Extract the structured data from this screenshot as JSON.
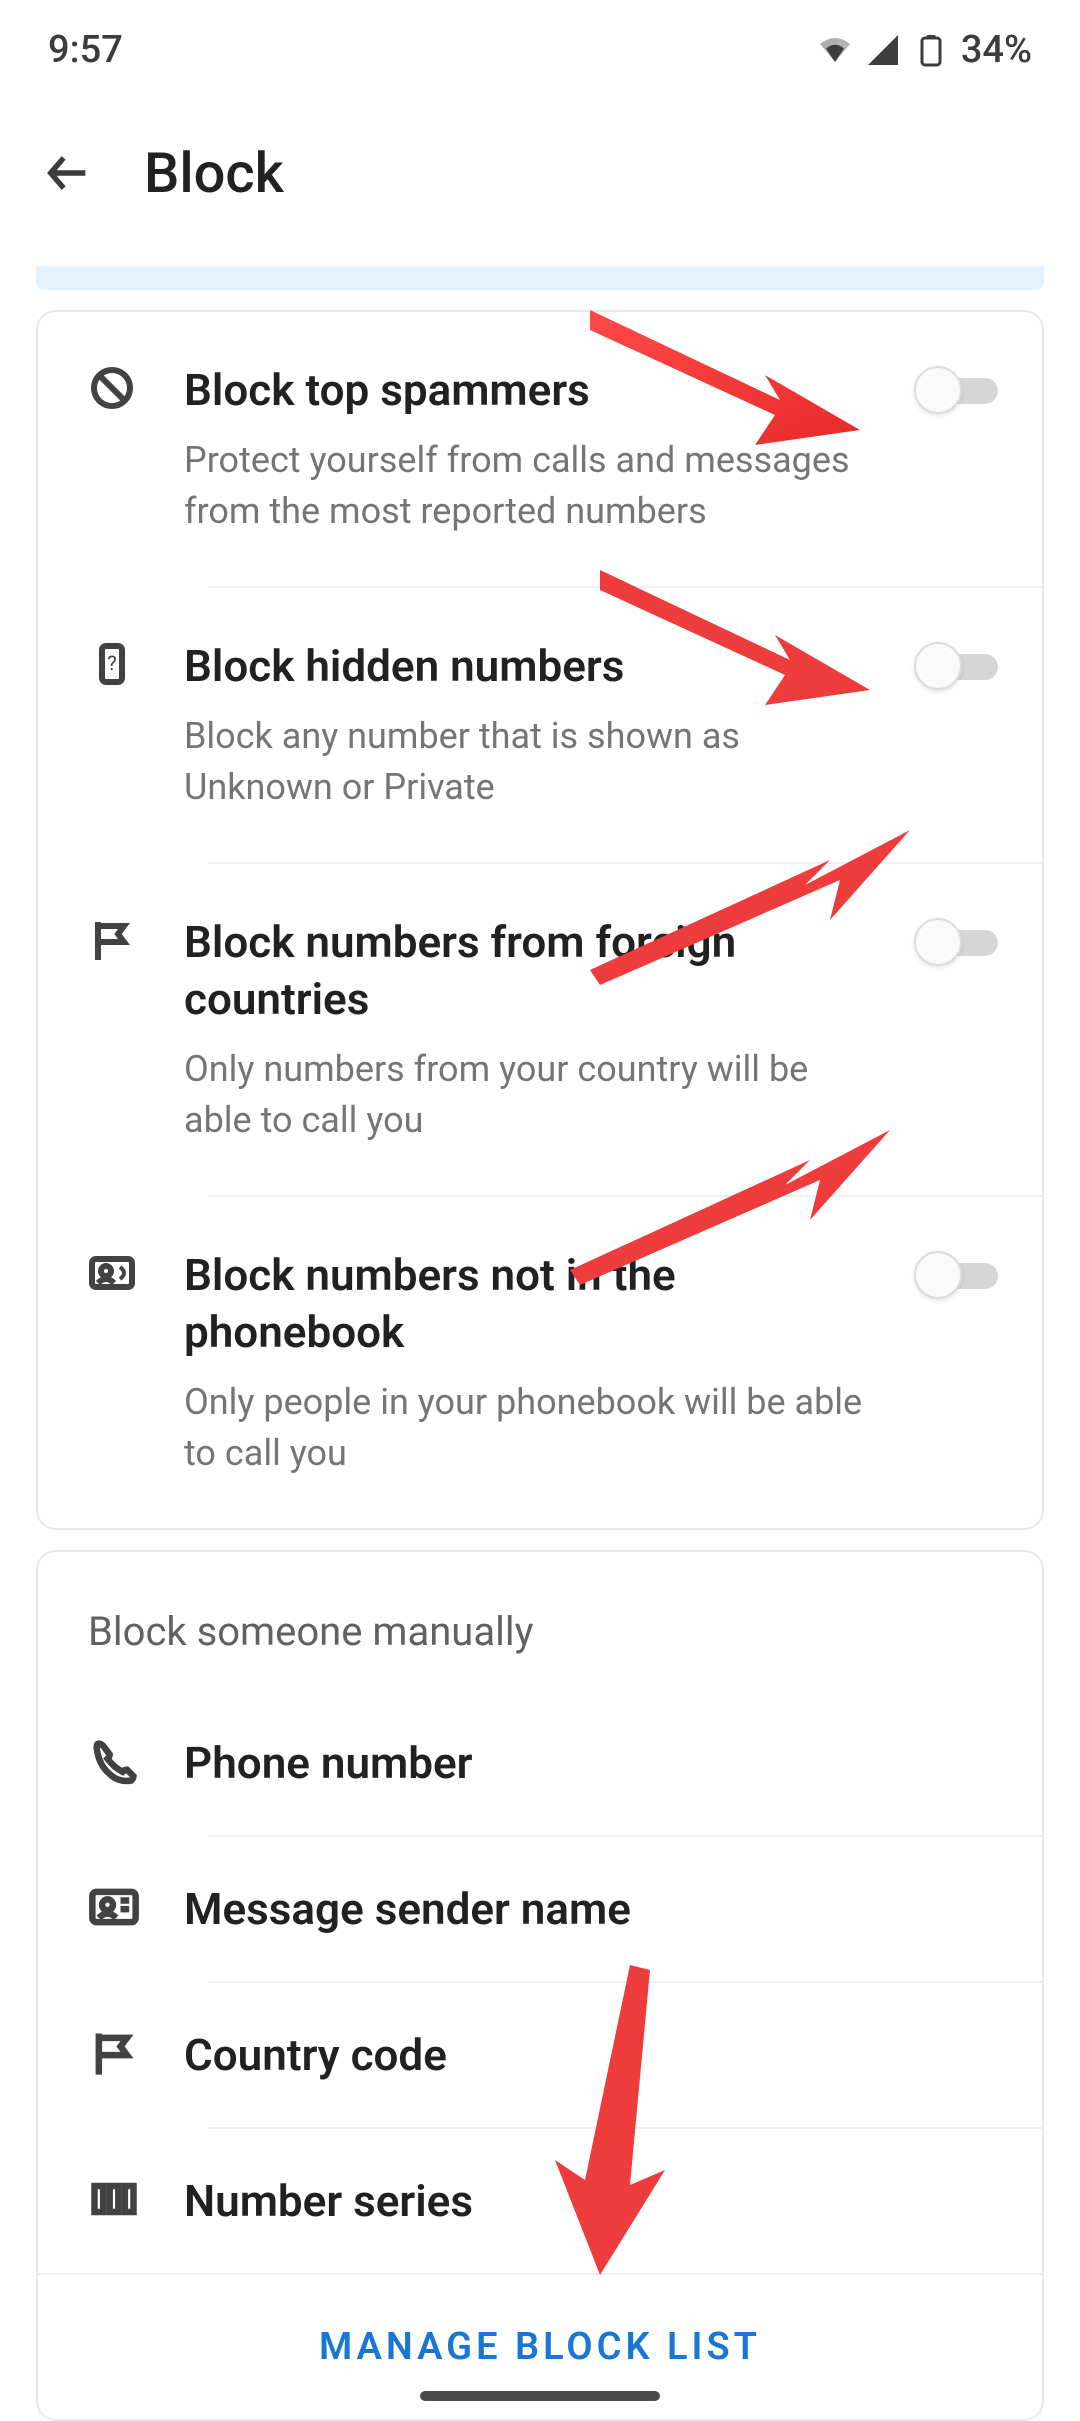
{
  "status": {
    "time": "9:57",
    "battery": "34%"
  },
  "header": {
    "title": "Block"
  },
  "settings_card": {
    "items": [
      {
        "title": "Block top spammers",
        "description": "Protect yourself from calls and messages from the most reported numbers",
        "toggled": false
      },
      {
        "title": "Block hidden numbers",
        "description": "Block any number that is shown as Unknown or Private",
        "toggled": false
      },
      {
        "title": "Block numbers from foreign countries",
        "description": "Only numbers from your country will be able to call you",
        "toggled": false
      },
      {
        "title": "Block numbers not in the phonebook",
        "description": "Only people in your phonebook will be able to call you",
        "toggled": false
      }
    ]
  },
  "manual_card": {
    "section_title": "Block someone manually",
    "items": [
      {
        "label": "Phone number"
      },
      {
        "label": "Message sender name"
      },
      {
        "label": "Country code"
      },
      {
        "label": "Number series"
      }
    ],
    "action": "MANAGE BLOCK LIST"
  }
}
